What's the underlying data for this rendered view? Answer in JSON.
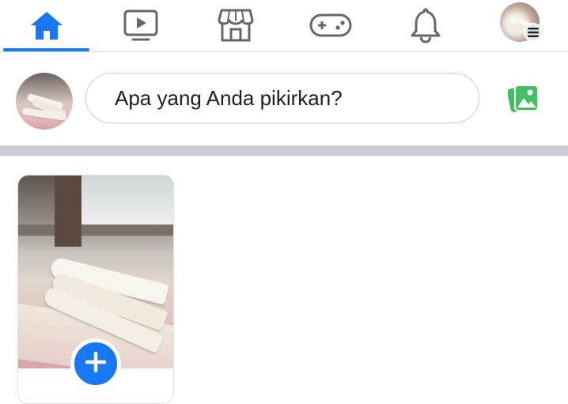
{
  "nav": {
    "items": [
      {
        "id": "home",
        "icon": "home-icon",
        "active": true
      },
      {
        "id": "watch",
        "icon": "video-icon"
      },
      {
        "id": "marketplace",
        "icon": "marketplace-icon"
      },
      {
        "id": "gaming",
        "icon": "gamepad-icon"
      },
      {
        "id": "notifications",
        "icon": "bell-icon"
      },
      {
        "id": "menu",
        "icon": "profile-avatar-with-menu-icon"
      }
    ]
  },
  "composer": {
    "placeholder": "Apa yang Anda pikirkan?",
    "photo_icon": "photo-icon"
  },
  "stories": {
    "create_icon": "plus-icon"
  },
  "colors": {
    "accent": "#1877f2",
    "icon_gray": "#65676b",
    "photo_green": "#45bd62",
    "separator": "#c9ccd1"
  }
}
